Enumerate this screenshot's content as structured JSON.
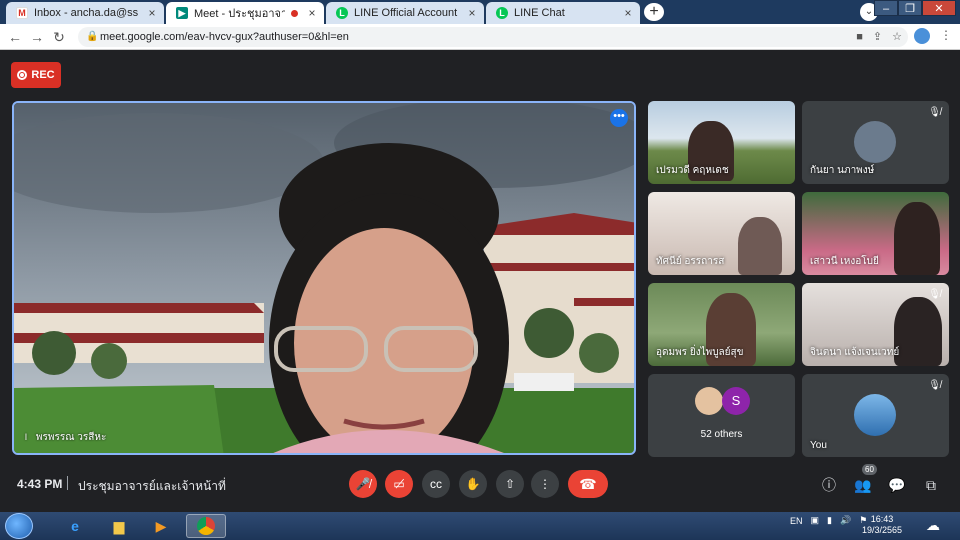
{
  "browser": {
    "tabs": [
      {
        "title": "Inbox - ancha.da@ssru.ac.th -",
        "favicon": "gmail-icon",
        "close": "×"
      },
      {
        "title": "Meet - ประชุมอาจารย์และเจ้าห",
        "favicon": "meet-icon",
        "close": "×"
      },
      {
        "title": "LINE Official Account Manager",
        "favicon": "line-icon",
        "close": "×"
      },
      {
        "title": "LINE Chat",
        "favicon": "line-icon",
        "close": "×"
      }
    ],
    "new_tab": "+",
    "url": "meet.google.com/eav-hvcv-gux?authuser=0&hl=en"
  },
  "meet": {
    "rec_label": "REC",
    "main_speaker": "พรพรรณ วรสีหะ",
    "participants": [
      {
        "name": "เปรมวดี คฤหเดช"
      },
      {
        "name": "กันยา นภาพงษ์"
      },
      {
        "name": "ทัศนีย์ อรรถารส"
      },
      {
        "name": "เสาวนี เหงอโบยี"
      },
      {
        "name": "อุดมพร ยิ่งไพบูลย์สุข"
      },
      {
        "name": "จินตนา แจ้งเจนเวทย์"
      }
    ],
    "others_avatar_letter": "S",
    "others_label": "52 others",
    "you_label": "You",
    "time": "4:43 PM",
    "meeting_title": "ประชุมอาจารย์และเจ้าหน้าที่",
    "people_count": "60"
  },
  "taskbar": {
    "lang": "EN",
    "clock_time": "16:43",
    "clock_date": "19/3/2565"
  },
  "colors": {
    "meet_bg": "#202124",
    "rec": "#d93025",
    "end_call": "#ea4335",
    "active_border": "#8ab4f8"
  }
}
